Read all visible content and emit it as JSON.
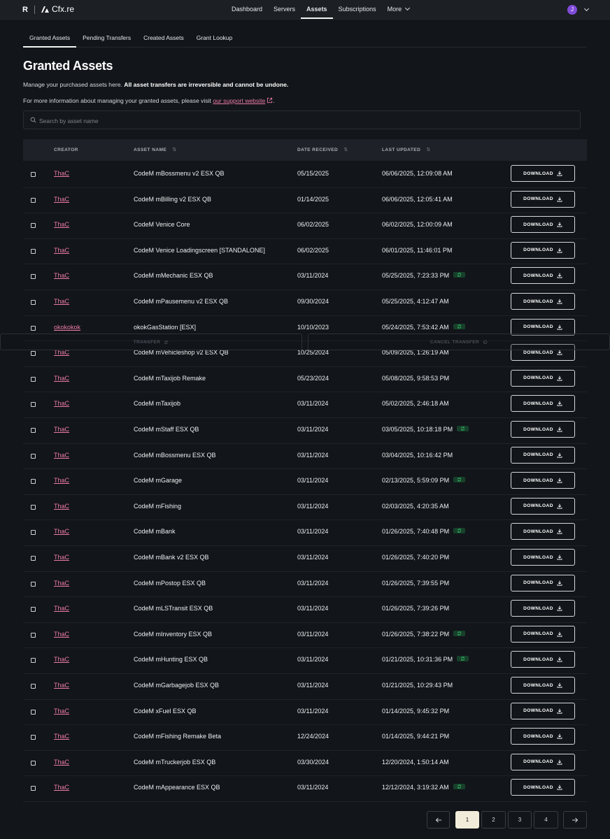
{
  "brand": {
    "r_logo": "R",
    "name": "Cfx.re"
  },
  "nav": {
    "links": [
      "Dashboard",
      "Servers",
      "Assets",
      "Subscriptions",
      "More"
    ],
    "active": "Assets",
    "avatar_initial": "J"
  },
  "subtabs": [
    "Granted Assets",
    "Pending Transfers",
    "Created Assets",
    "Grant Lookup"
  ],
  "page": {
    "title": "Granted Assets",
    "desc_intro": "Manage your purchased assets here. ",
    "desc_bold": "All asset transfers are irreversible and cannot be undone.",
    "info_text": "For more information about managing your granted assets, please visit ",
    "info_link": "our support website",
    "info_end": "."
  },
  "search": {
    "placeholder": "Search by asset name",
    "value": ""
  },
  "table": {
    "columns": [
      "CREATOR",
      "ASSET NAME",
      "DATE RECEIVED",
      "LAST UPDATED"
    ],
    "download_label": "DOWNLOAD",
    "rows": [
      {
        "creator": "ThaC",
        "name": "CodeM mBossmenu v2 ESX QB",
        "received": "05/15/2025",
        "updated": "06/06/2025, 12:09:08 AM",
        "synced": false
      },
      {
        "creator": "ThaC",
        "name": "CodeM mBilling v2 ESX QB",
        "received": "01/14/2025",
        "updated": "06/06/2025, 12:05:41 AM",
        "synced": false
      },
      {
        "creator": "ThaC",
        "name": "CodeM Venice Core",
        "received": "06/02/2025",
        "updated": "06/02/2025, 12:00:09 AM",
        "synced": false
      },
      {
        "creator": "ThaC",
        "name": "CodeM Venice Loadingscreen [STANDALONE]",
        "received": "06/02/2025",
        "updated": "06/01/2025, 11:46:01 PM",
        "synced": false
      },
      {
        "creator": "ThaC",
        "name": "CodeM mMechanic ESX QB",
        "received": "03/11/2024",
        "updated": "05/25/2025, 7:23:33 PM",
        "synced": true
      },
      {
        "creator": "ThaC",
        "name": "CodeM mPausemenu v2 ESX QB",
        "received": "09/30/2024",
        "updated": "05/25/2025, 4:12:47 AM",
        "synced": false
      },
      {
        "creator": "okokokok",
        "name": "okokGasStation [ESX]",
        "received": "10/10/2023",
        "updated": "05/24/2025, 7:53:42 AM",
        "synced": true
      },
      {
        "creator": "ThaC",
        "name": "CodeM mVehicleshop v2 ESX QB",
        "received": "10/25/2024",
        "updated": "05/09/2025, 1:26:19 AM",
        "synced": false
      },
      {
        "creator": "ThaC",
        "name": "CodeM mTaxijob Remake",
        "received": "05/23/2024",
        "updated": "05/08/2025, 9:58:53 PM",
        "synced": false
      },
      {
        "creator": "ThaC",
        "name": "CodeM mTaxijob",
        "received": "03/11/2024",
        "updated": "05/02/2025, 2:46:18 AM",
        "synced": false
      },
      {
        "creator": "ThaC",
        "name": "CodeM mStaff ESX QB",
        "received": "03/11/2024",
        "updated": "03/05/2025, 10:18:18 PM",
        "synced": true
      },
      {
        "creator": "ThaC",
        "name": "CodeM mBossmenu ESX QB",
        "received": "03/11/2024",
        "updated": "03/04/2025, 10:16:42 PM",
        "synced": false
      },
      {
        "creator": "ThaC",
        "name": "CodeM mGarage",
        "received": "03/11/2024",
        "updated": "02/13/2025, 5:59:09 PM",
        "synced": true
      },
      {
        "creator": "ThaC",
        "name": "CodeM mFishing",
        "received": "03/11/2024",
        "updated": "02/03/2025, 4:20:35 AM",
        "synced": false
      },
      {
        "creator": "ThaC",
        "name": "CodeM mBank",
        "received": "03/11/2024",
        "updated": "01/26/2025, 7:40:48 PM",
        "synced": true
      },
      {
        "creator": "ThaC",
        "name": "CodeM mBank v2 ESX QB",
        "received": "03/11/2024",
        "updated": "01/26/2025, 7:40:20 PM",
        "synced": false
      },
      {
        "creator": "ThaC",
        "name": "CodeM mPostop ESX QB",
        "received": "03/11/2024",
        "updated": "01/26/2025, 7:39:55 PM",
        "synced": false
      },
      {
        "creator": "ThaC",
        "name": "CodeM mLSTransit ESX QB",
        "received": "03/11/2024",
        "updated": "01/26/2025, 7:39:26 PM",
        "synced": false
      },
      {
        "creator": "ThaC",
        "name": "CodeM mInventory ESX QB",
        "received": "03/11/2024",
        "updated": "01/26/2025, 7:38:22 PM",
        "synced": true
      },
      {
        "creator": "ThaC",
        "name": "CodeM mHunting ESX QB",
        "received": "03/11/2024",
        "updated": "01/21/2025, 10:31:36 PM",
        "synced": true
      },
      {
        "creator": "ThaC",
        "name": "CodeM mGarbagejob ESX QB",
        "received": "03/11/2024",
        "updated": "01/21/2025, 10:29:43 PM",
        "synced": false
      },
      {
        "creator": "ThaC",
        "name": "CodeM xFuel ESX QB",
        "received": "03/11/2024",
        "updated": "01/14/2025, 9:45:32 PM",
        "synced": false
      },
      {
        "creator": "ThaC",
        "name": "CodeM mFishing Remake Beta",
        "received": "12/24/2024",
        "updated": "01/14/2025, 9:44:21 PM",
        "synced": false
      },
      {
        "creator": "ThaC",
        "name": "CodeM mTruckerjob ESX QB",
        "received": "03/30/2024",
        "updated": "12/20/2024, 1:50:14 AM",
        "synced": false
      },
      {
        "creator": "ThaC",
        "name": "CodeM mAppearance ESX QB",
        "received": "03/11/2024",
        "updated": "12/12/2024, 3:19:32 AM",
        "synced": true
      }
    ]
  },
  "transfer_bar": {
    "transfer_label": "TRANSFER",
    "cancel_label": "CANCEL TRANSFER"
  },
  "pagination": {
    "pages": [
      "1",
      "2",
      "3",
      "4"
    ],
    "current": "1"
  },
  "colors": {
    "accent_pink": "#ec7aab",
    "background": "#121519",
    "sync_badge": "#17402a",
    "avatar": "#7f4bd8",
    "active_page": "#f1ecd9"
  }
}
